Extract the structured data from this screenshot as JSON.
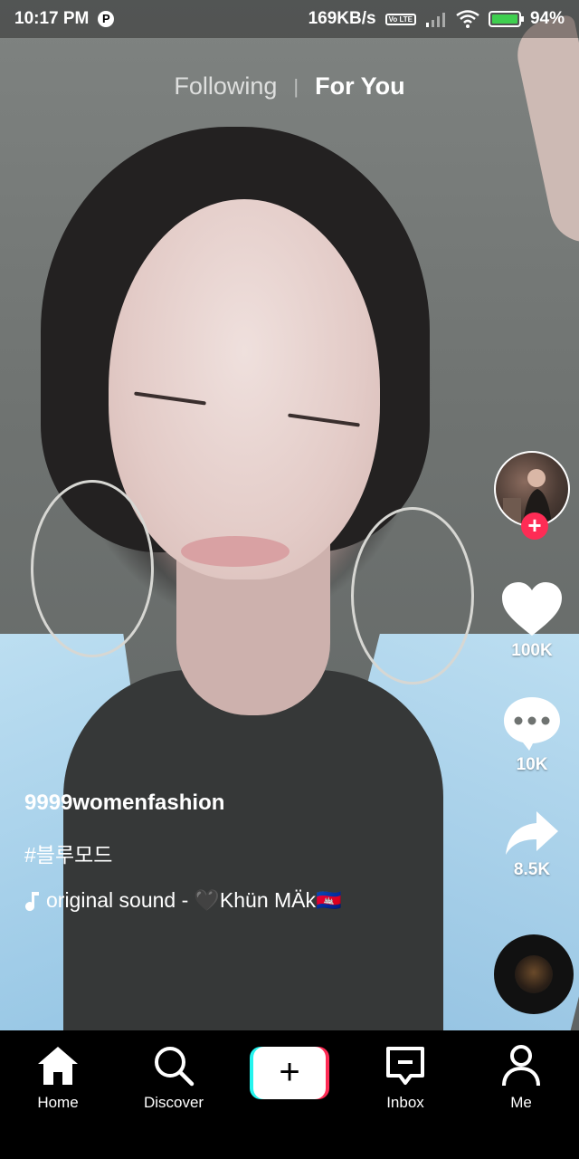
{
  "status_bar": {
    "time": "10:17 PM",
    "app_icon_letter": "P",
    "network_speed": "169KB/s",
    "volte": "Vo LTE",
    "battery": "94%"
  },
  "top_tabs": {
    "following": "Following",
    "divider": "|",
    "for_you": "For You"
  },
  "rail": {
    "follow_symbol": "+",
    "likes": "100K",
    "comments": "10K",
    "shares": "8.5K"
  },
  "caption": {
    "username": "9999womenfashion",
    "hashtag": "#블루모드",
    "sound_prefix": "original sound - ",
    "sound_author": "🖤Khün MÄk🇰🇭"
  },
  "bottom_nav": {
    "home": "Home",
    "discover": "Discover",
    "create_symbol": "+",
    "inbox": "Inbox",
    "me": "Me"
  },
  "colors": {
    "accent_red": "#fe2c55",
    "accent_cyan": "#25f4ee",
    "battery_green": "#3fcf4f"
  }
}
